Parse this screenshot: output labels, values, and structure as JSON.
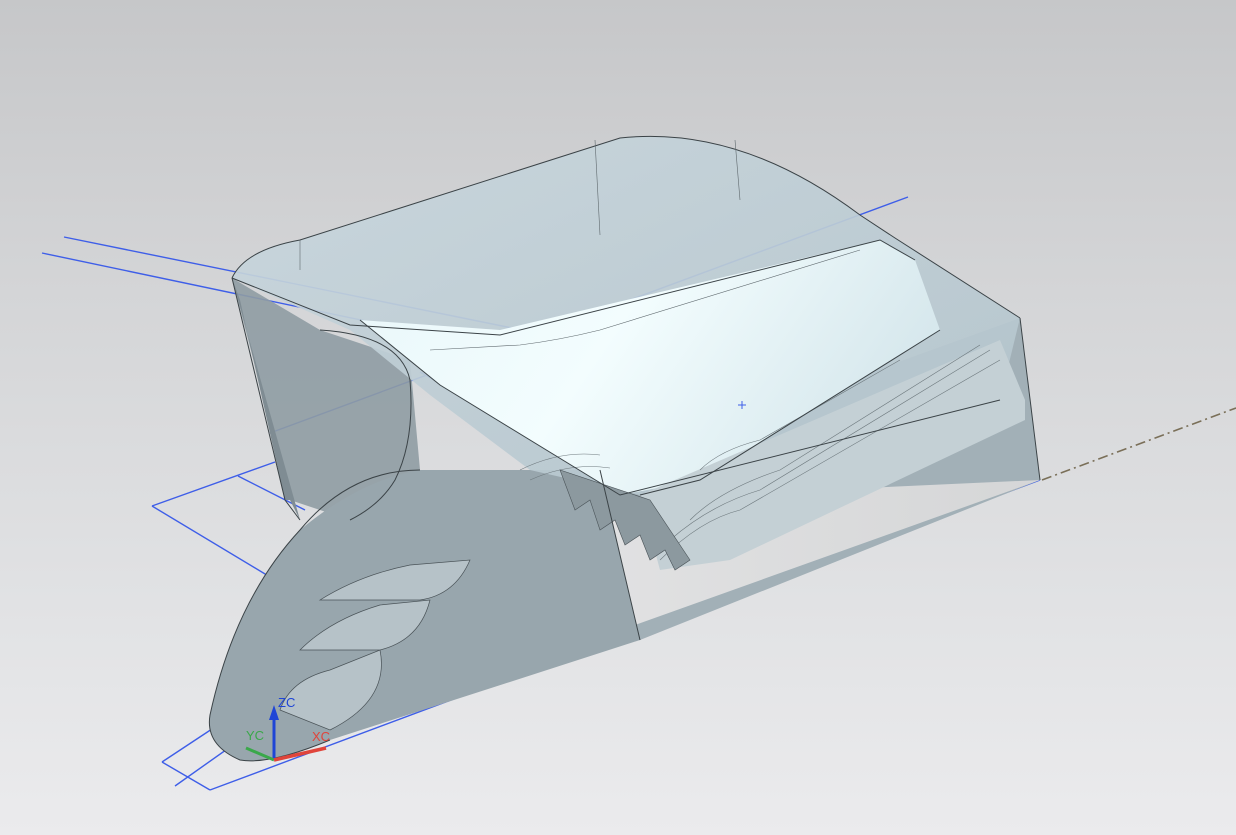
{
  "viewport": {
    "background_top": "#c6c7c9",
    "background_bottom": "#ebebed"
  },
  "model": {
    "body_color": "#aebcc3",
    "highlight_color": "#eefbfd",
    "edge_color": "#3b4347",
    "sketch_color": "#3e5ee8",
    "centerline_color": "#7a6f58"
  },
  "triad": {
    "zc_label": "ZC",
    "yc_label": "YC",
    "xc_label": "XC",
    "zc_color": "#1f45d6",
    "yc_color": "#3aa84a",
    "xc_color": "#e0443b"
  }
}
